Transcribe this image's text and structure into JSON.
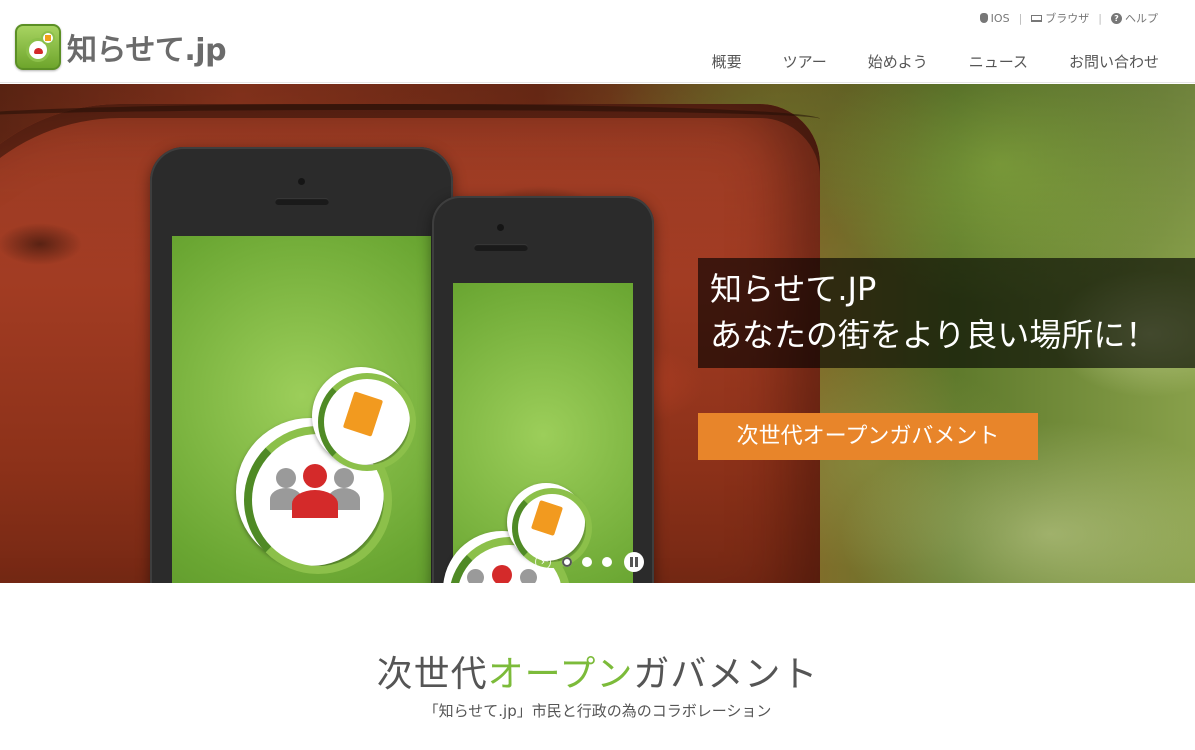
{
  "header": {
    "logo_text": "知らせて.jp",
    "utility_links": [
      {
        "label": "IOS",
        "icon": "apple-icon"
      },
      {
        "label": "ブラウザ",
        "icon": "laptop-icon"
      },
      {
        "label": "ヘルプ",
        "icon": "help-icon"
      }
    ],
    "nav": [
      "概要",
      "ツアー",
      "始めよう",
      "ニュース",
      "お問い合わせ"
    ]
  },
  "hero": {
    "caption_line1": "知らせて.JP",
    "caption_line2": "あなたの街をより良い場所に！",
    "cta_label": "次世代オープンガバメント",
    "slide_count": 3,
    "active_slide": 1
  },
  "intro": {
    "title_part1": "次世代",
    "title_accent": "オープン",
    "title_part2": "ガバメント",
    "subtitle": "「知らせて.jp」市民と行政の為のコラボレーション"
  },
  "colors": {
    "accent_green": "#7cbb3a",
    "cta_orange": "#e8852a",
    "text_gray": "#555555"
  }
}
